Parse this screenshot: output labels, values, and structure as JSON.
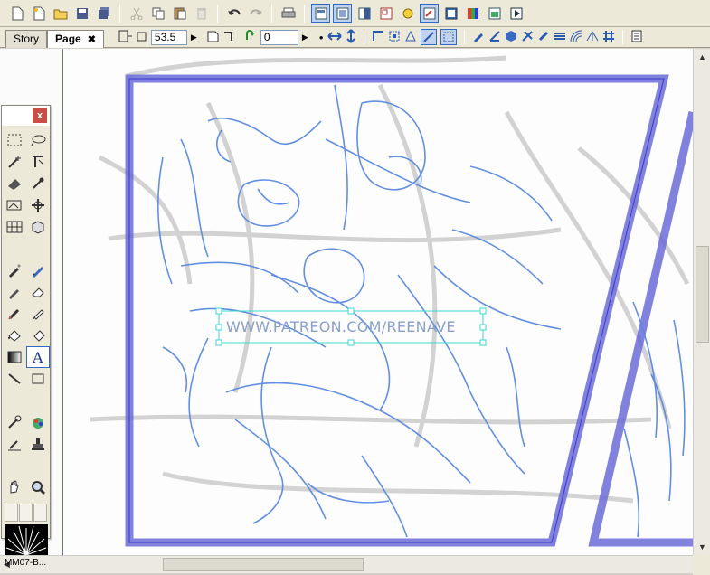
{
  "tabs": [
    {
      "label": "Story",
      "active": false
    },
    {
      "label": "Page",
      "active": true,
      "close": "✖"
    }
  ],
  "toolbar2": {
    "zoom_value": "53.5",
    "rotate_value": "0"
  },
  "watermark": "WWW.PATREON.COM/REENAVE",
  "palette": {
    "close_label": "x",
    "brush_label": "MM07-B..."
  },
  "colors": {
    "panel_border": "#6b6bd8",
    "sketch": "#5a8ae0",
    "selection": "#3fd6d6"
  }
}
